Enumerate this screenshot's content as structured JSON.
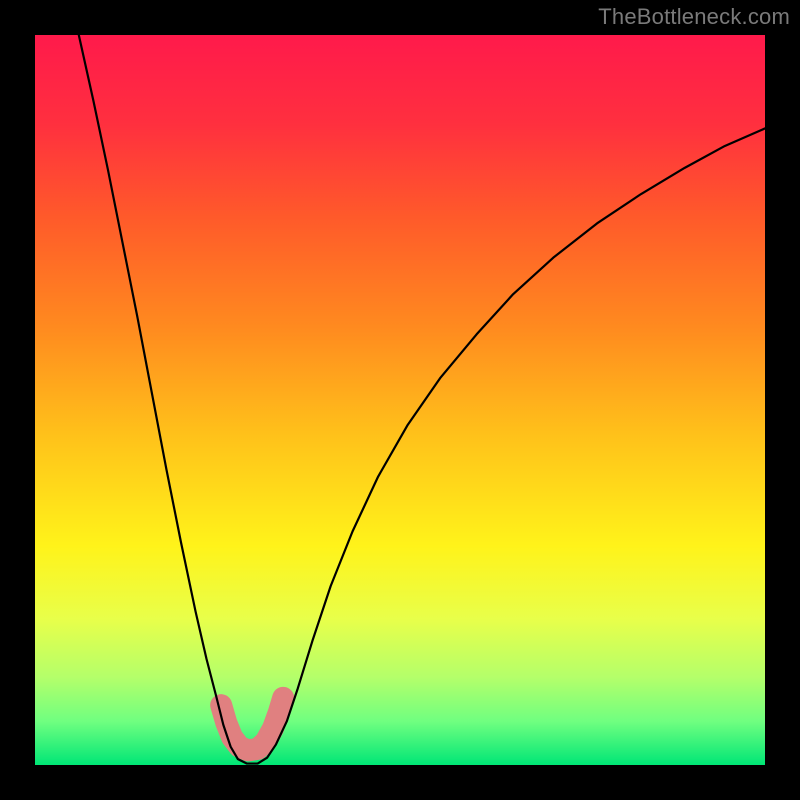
{
  "watermark": "TheBottleneck.com",
  "gradient": {
    "stops": [
      {
        "offset": 0.0,
        "color": "#ff1a4b"
      },
      {
        "offset": 0.12,
        "color": "#ff2f3f"
      },
      {
        "offset": 0.25,
        "color": "#ff5a2a"
      },
      {
        "offset": 0.4,
        "color": "#ff8a1f"
      },
      {
        "offset": 0.55,
        "color": "#ffc21a"
      },
      {
        "offset": 0.7,
        "color": "#fff31a"
      },
      {
        "offset": 0.8,
        "color": "#e8ff4a"
      },
      {
        "offset": 0.88,
        "color": "#b4ff6a"
      },
      {
        "offset": 0.94,
        "color": "#70ff80"
      },
      {
        "offset": 1.0,
        "color": "#00e676"
      }
    ]
  },
  "curve": {
    "color": "#000000",
    "width": 2.2,
    "points": [
      {
        "x": 0.06,
        "y": 0.0
      },
      {
        "x": 0.08,
        "y": 0.09
      },
      {
        "x": 0.1,
        "y": 0.185
      },
      {
        "x": 0.12,
        "y": 0.285
      },
      {
        "x": 0.14,
        "y": 0.385
      },
      {
        "x": 0.16,
        "y": 0.49
      },
      {
        "x": 0.18,
        "y": 0.595
      },
      {
        "x": 0.2,
        "y": 0.695
      },
      {
        "x": 0.22,
        "y": 0.79
      },
      {
        "x": 0.235,
        "y": 0.855
      },
      {
        "x": 0.248,
        "y": 0.905
      },
      {
        "x": 0.258,
        "y": 0.945
      },
      {
        "x": 0.268,
        "y": 0.975
      },
      {
        "x": 0.278,
        "y": 0.992
      },
      {
        "x": 0.29,
        "y": 0.998
      },
      {
        "x": 0.305,
        "y": 0.998
      },
      {
        "x": 0.318,
        "y": 0.99
      },
      {
        "x": 0.33,
        "y": 0.972
      },
      {
        "x": 0.345,
        "y": 0.94
      },
      {
        "x": 0.36,
        "y": 0.895
      },
      {
        "x": 0.38,
        "y": 0.83
      },
      {
        "x": 0.405,
        "y": 0.755
      },
      {
        "x": 0.435,
        "y": 0.68
      },
      {
        "x": 0.47,
        "y": 0.605
      },
      {
        "x": 0.51,
        "y": 0.535
      },
      {
        "x": 0.555,
        "y": 0.47
      },
      {
        "x": 0.605,
        "y": 0.41
      },
      {
        "x": 0.655,
        "y": 0.355
      },
      {
        "x": 0.71,
        "y": 0.305
      },
      {
        "x": 0.77,
        "y": 0.258
      },
      {
        "x": 0.83,
        "y": 0.218
      },
      {
        "x": 0.89,
        "y": 0.182
      },
      {
        "x": 0.945,
        "y": 0.152
      },
      {
        "x": 1.0,
        "y": 0.128
      }
    ]
  },
  "marker_band": {
    "color": "#e08080",
    "width": 22,
    "points": [
      {
        "x": 0.255,
        "y": 0.918
      },
      {
        "x": 0.262,
        "y": 0.942
      },
      {
        "x": 0.27,
        "y": 0.962
      },
      {
        "x": 0.28,
        "y": 0.975
      },
      {
        "x": 0.292,
        "y": 0.98
      },
      {
        "x": 0.305,
        "y": 0.978
      },
      {
        "x": 0.316,
        "y": 0.968
      },
      {
        "x": 0.326,
        "y": 0.95
      },
      {
        "x": 0.334,
        "y": 0.928
      },
      {
        "x": 0.34,
        "y": 0.908
      }
    ]
  },
  "chart_data": {
    "type": "line",
    "title": "",
    "xlabel": "",
    "ylabel": "",
    "xlim": [
      0,
      1
    ],
    "ylim": [
      0,
      1
    ],
    "series": [
      {
        "name": "bottleneck-curve",
        "x": [
          0.06,
          0.08,
          0.1,
          0.12,
          0.14,
          0.16,
          0.18,
          0.2,
          0.22,
          0.235,
          0.248,
          0.258,
          0.268,
          0.278,
          0.29,
          0.305,
          0.318,
          0.33,
          0.345,
          0.36,
          0.38,
          0.405,
          0.435,
          0.47,
          0.51,
          0.555,
          0.605,
          0.655,
          0.71,
          0.77,
          0.83,
          0.89,
          0.945,
          1.0
        ],
        "y": [
          1.0,
          0.91,
          0.815,
          0.715,
          0.615,
          0.51,
          0.405,
          0.305,
          0.21,
          0.145,
          0.095,
          0.055,
          0.025,
          0.008,
          0.002,
          0.002,
          0.01,
          0.028,
          0.06,
          0.105,
          0.17,
          0.245,
          0.32,
          0.395,
          0.465,
          0.53,
          0.59,
          0.645,
          0.695,
          0.742,
          0.782,
          0.818,
          0.848,
          0.872
        ]
      },
      {
        "name": "highlight-band",
        "x": [
          0.255,
          0.262,
          0.27,
          0.28,
          0.292,
          0.305,
          0.316,
          0.326,
          0.334,
          0.34
        ],
        "y": [
          0.082,
          0.058,
          0.038,
          0.025,
          0.02,
          0.022,
          0.032,
          0.05,
          0.072,
          0.092
        ]
      }
    ],
    "annotations": [
      {
        "text": "TheBottleneck.com",
        "position": "top-right"
      }
    ]
  }
}
